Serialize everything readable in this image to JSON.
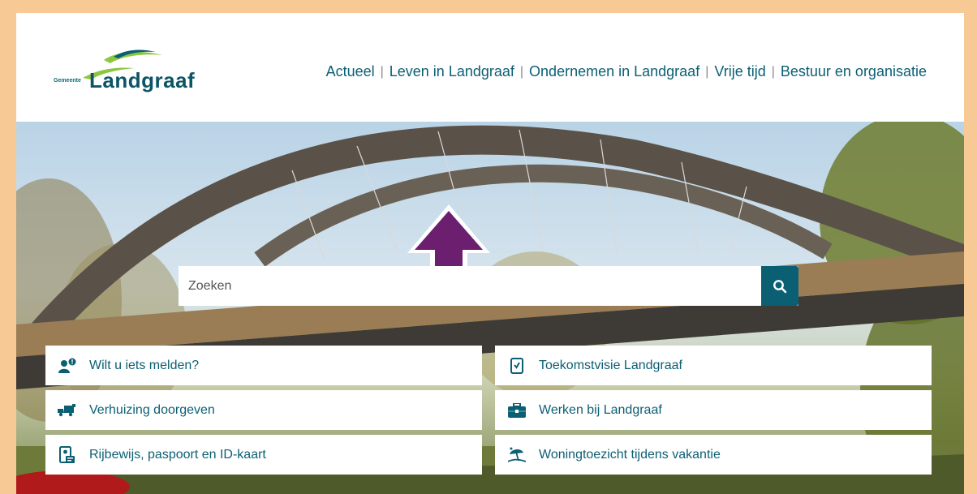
{
  "logo": {
    "prefix": "Gemeente",
    "name": "Landgraaf"
  },
  "nav": {
    "items": [
      {
        "label": "Actueel"
      },
      {
        "label": "Leven in Landgraaf"
      },
      {
        "label": "Ondernemen in Landgraaf"
      },
      {
        "label": "Vrije tijd"
      },
      {
        "label": "Bestuur en organisatie"
      }
    ],
    "separator": "|"
  },
  "search": {
    "placeholder": "Zoeken",
    "value": ""
  },
  "tiles": {
    "left": [
      {
        "label": "Wilt u iets melden?",
        "icon": "report-person-icon"
      },
      {
        "label": "Verhuizing doorgeven",
        "icon": "moving-truck-icon"
      },
      {
        "label": "Rijbewijs, paspoort en ID-kaart",
        "icon": "id-card-icon"
      }
    ],
    "right": [
      {
        "label": "Toekomstvisie Landgraaf",
        "icon": "document-check-icon"
      },
      {
        "label": "Werken bij Landgraaf",
        "icon": "briefcase-icon"
      },
      {
        "label": "Woningtoezicht tijdens vakantie",
        "icon": "beach-umbrella-icon"
      }
    ]
  },
  "colors": {
    "accent": "#0b5f73",
    "frame": "#f6c995",
    "arrow": "#6b1f6e"
  }
}
